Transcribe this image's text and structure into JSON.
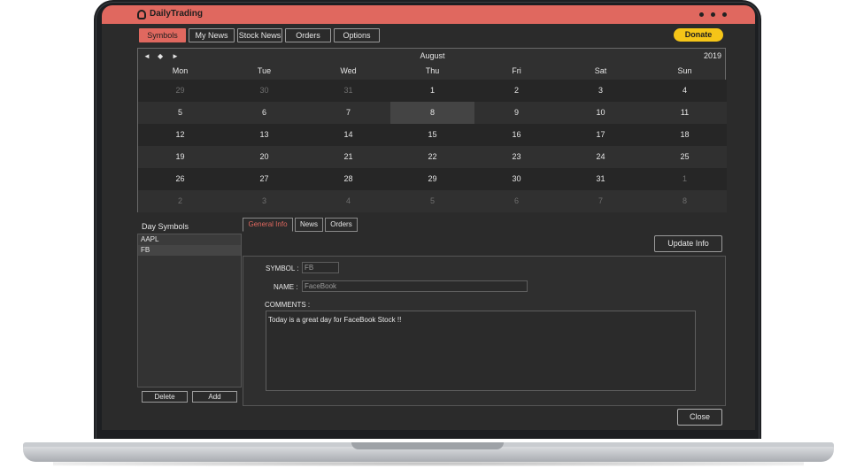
{
  "app": {
    "title": "DailyTrading"
  },
  "toolbar": {
    "tabs": [
      "Symbols",
      "My News",
      "Stock News",
      "Orders",
      "Options"
    ],
    "donate_label": "Donate"
  },
  "calendar": {
    "month": "August",
    "year": "2019",
    "nav": {
      "prev": "◄",
      "today": "◆",
      "next": "►"
    },
    "weekdays": [
      "Mon",
      "Tue",
      "Wed",
      "Thu",
      "Fri",
      "Sat",
      "Sun"
    ],
    "weeks": [
      [
        "29",
        "30",
        "31",
        "1",
        "2",
        "3",
        "4"
      ],
      [
        "5",
        "6",
        "7",
        "8",
        "9",
        "10",
        "11"
      ],
      [
        "12",
        "13",
        "14",
        "15",
        "16",
        "17",
        "18"
      ],
      [
        "19",
        "20",
        "21",
        "22",
        "23",
        "24",
        "25"
      ],
      [
        "26",
        "27",
        "28",
        "29",
        "30",
        "31",
        "1"
      ],
      [
        "2",
        "3",
        "4",
        "5",
        "6",
        "7",
        "8"
      ]
    ],
    "selected_day": "8"
  },
  "day_symbols": {
    "label": "Day Symbols",
    "items": [
      "AAPL",
      "FB"
    ],
    "selected": "FB",
    "delete_label": "Delete",
    "add_label": "Add"
  },
  "info": {
    "tabs": [
      "General Info",
      "News",
      "Orders"
    ],
    "update_label": "Update Info",
    "symbol_label": "SYMBOL :",
    "symbol_value": "FB",
    "name_label": "NAME :",
    "name_value": "FaceBook",
    "comments_label": "COMMENTS :",
    "comments_value": "Today is a great day for FaceBook Stock !!"
  },
  "footer": {
    "close_label": "Close"
  },
  "colors": {
    "accent": "#e0685f",
    "donate": "#f5c518",
    "background": "#2b2b2b"
  }
}
